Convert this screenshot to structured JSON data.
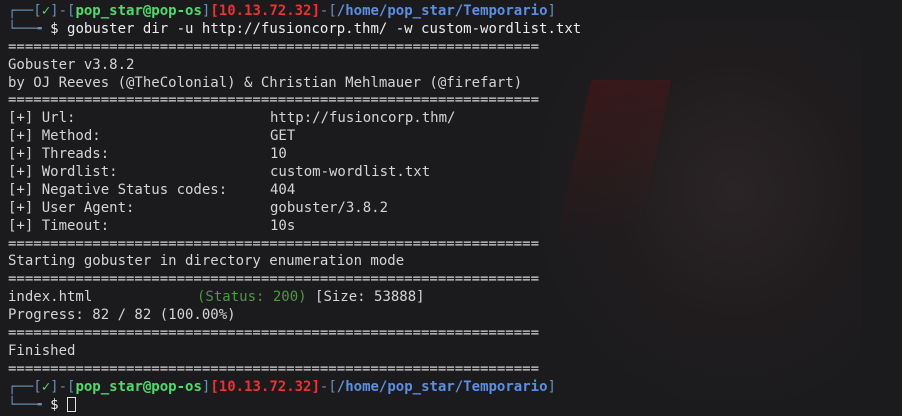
{
  "prompt": {
    "check": "✓",
    "user_host": "pop_star@pop-os",
    "ip": "10.13.72.32",
    "path": "/home/pop_star/Temporario",
    "dollar": "$"
  },
  "command": "gobuster dir -u http://fusioncorp.thm/ -w custom-wordlist.txt",
  "separator": "===============================================================",
  "banner": {
    "version": "Gobuster v3.8.2",
    "authors": "by OJ Reeves (@TheColonial) & Christian Mehlmauer (@firefart)"
  },
  "config": [
    {
      "key": "[+] Url:",
      "value": "http://fusioncorp.thm/"
    },
    {
      "key": "[+] Method:",
      "value": "GET"
    },
    {
      "key": "[+] Threads:",
      "value": "10"
    },
    {
      "key": "[+] Wordlist:",
      "value": "custom-wordlist.txt"
    },
    {
      "key": "[+] Negative Status codes:",
      "value": "404"
    },
    {
      "key": "[+] User Agent:",
      "value": "gobuster/3.8.2"
    },
    {
      "key": "[+] Timeout:",
      "value": "10s"
    }
  ],
  "starting": "Starting gobuster in directory enumeration mode",
  "result": {
    "path": "index.html",
    "status": "(Status: 200)",
    "size": "[Size: 53888]"
  },
  "progress": "Progress: 82 / 82 (100.00%)",
  "finished": "Finished"
}
